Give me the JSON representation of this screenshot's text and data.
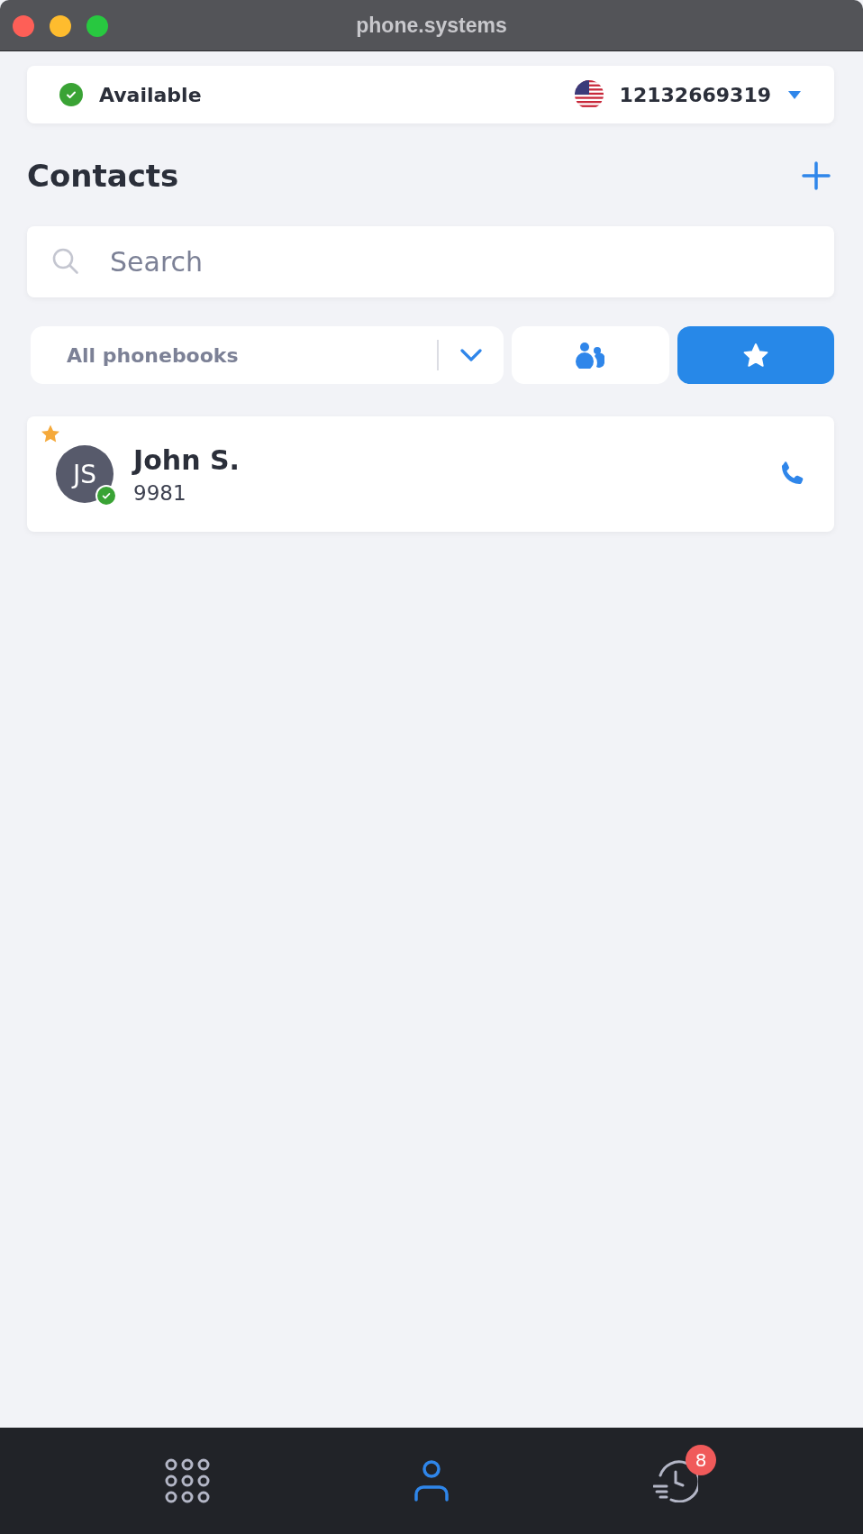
{
  "window": {
    "title": "phone.systems"
  },
  "status": {
    "label": "Available",
    "online": true,
    "number": "12132669319"
  },
  "header": {
    "title": "Contacts"
  },
  "search": {
    "placeholder": "Search"
  },
  "filters": {
    "phonebook": "All phonebooks",
    "toggles": [
      {
        "kind": "groups",
        "selected": false
      },
      {
        "kind": "favorites",
        "selected": true
      }
    ]
  },
  "contacts": [
    {
      "initials": "JS",
      "name": "John S.",
      "extension": "9981",
      "favorite": true,
      "online": true
    }
  ],
  "nav": [
    {
      "kind": "keypad",
      "selected": false
    },
    {
      "kind": "contacts",
      "selected": true
    },
    {
      "kind": "history",
      "selected": false,
      "badge": "8"
    }
  ]
}
